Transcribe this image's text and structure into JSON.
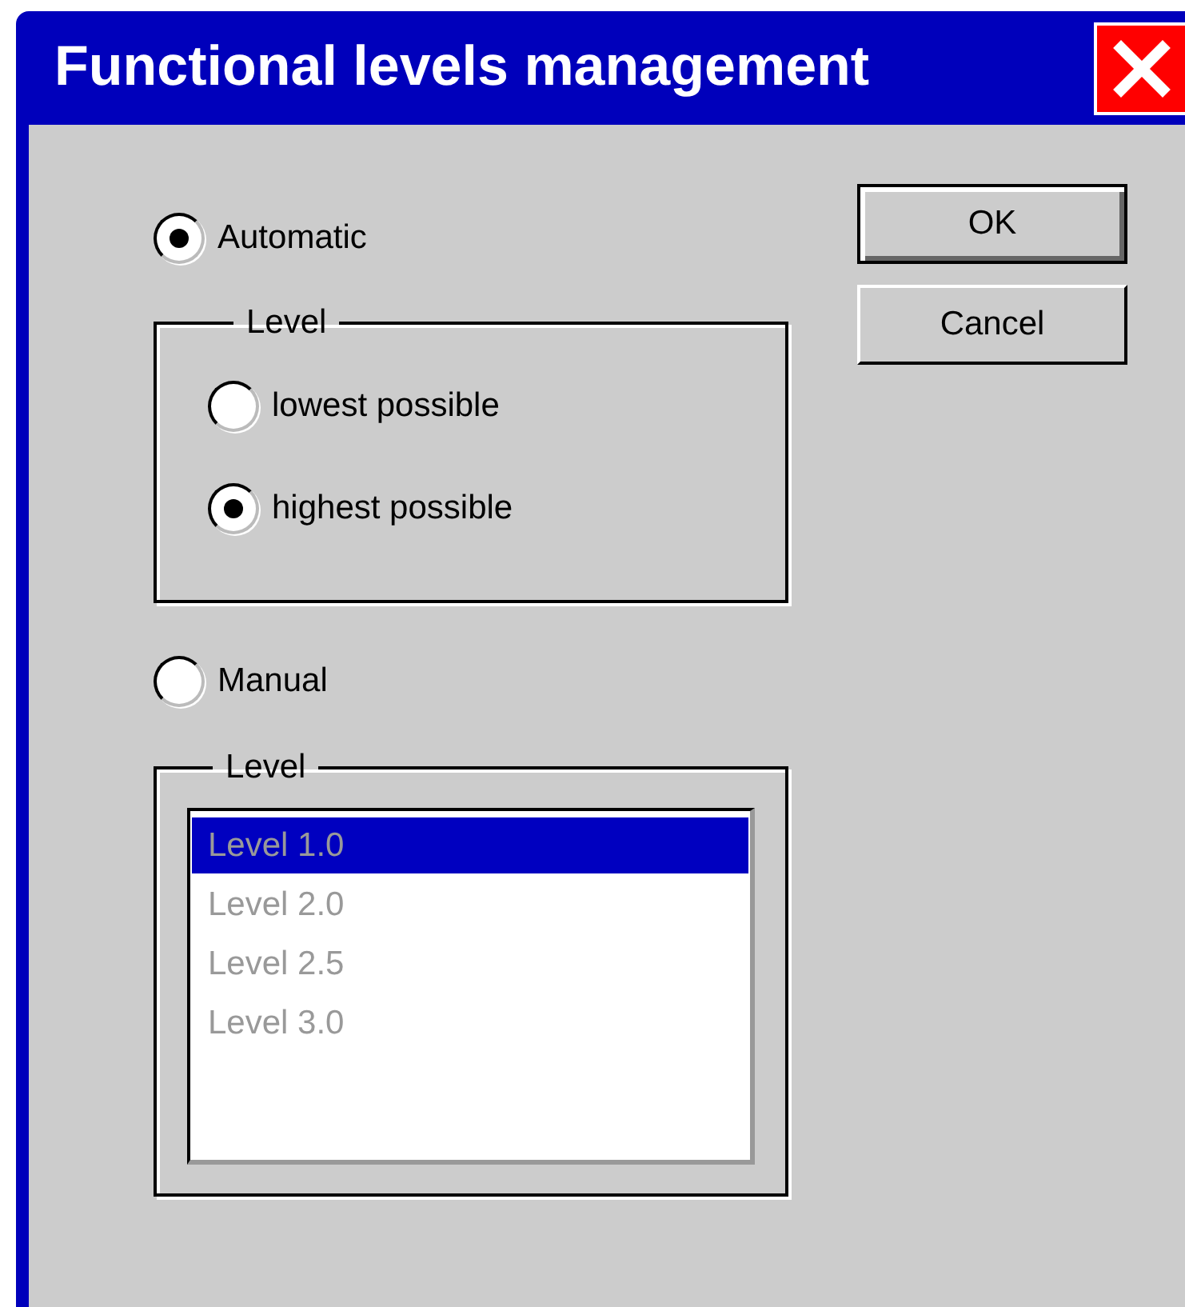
{
  "window": {
    "title": "Functional levels management"
  },
  "automatic": {
    "label": "Automatic",
    "selected": true
  },
  "automatic_group": {
    "legend": "Level",
    "options": [
      {
        "label": "lowest possible",
        "selected": false
      },
      {
        "label": "highest possible",
        "selected": true
      }
    ]
  },
  "manual": {
    "label": "Manual",
    "selected": false
  },
  "manual_group": {
    "legend": "Level",
    "list": {
      "disabled": true,
      "items": [
        {
          "label": "Level 1.0",
          "selected": true
        },
        {
          "label": "Level 2.0",
          "selected": false
        },
        {
          "label": "Level 2.5",
          "selected": false
        },
        {
          "label": "Level 3.0",
          "selected": false
        }
      ]
    }
  },
  "buttons": [
    {
      "label": "OK",
      "default": true
    },
    {
      "label": "Cancel",
      "default": false
    }
  ]
}
